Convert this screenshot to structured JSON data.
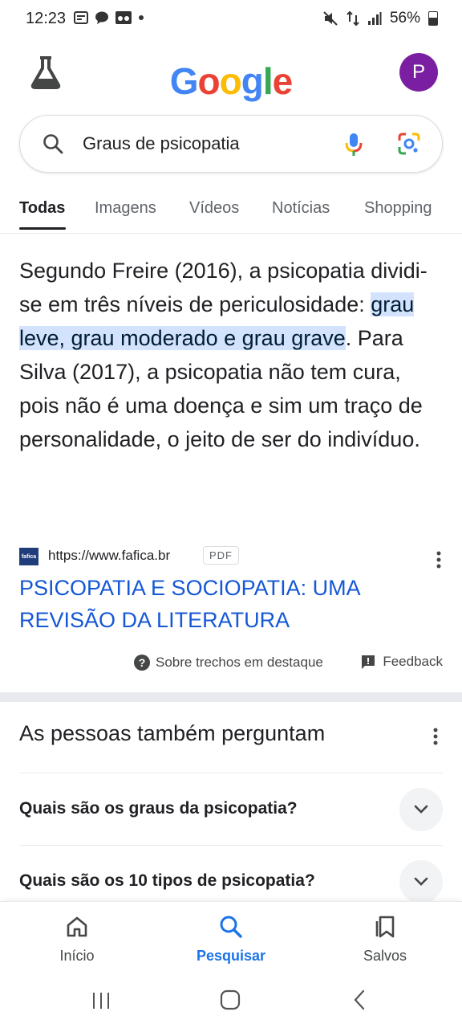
{
  "status_bar": {
    "time": "12:23",
    "battery": "56%"
  },
  "header": {
    "logo": [
      "G",
      "o",
      "o",
      "g",
      "l",
      "e"
    ],
    "logo_colors": [
      "#4285F4",
      "#EA4335",
      "#FBBC05",
      "#4285F4",
      "#34A853",
      "#EA4335"
    ],
    "avatar_initial": "P",
    "avatar_color": "#7b1fa2"
  },
  "search": {
    "query": "Graus de psicopatia"
  },
  "tabs": [
    {
      "label": "Todas",
      "active": true
    },
    {
      "label": "Imagens",
      "active": false
    },
    {
      "label": "Vídeos",
      "active": false
    },
    {
      "label": "Notícias",
      "active": false
    },
    {
      "label": "Shopping",
      "active": false
    }
  ],
  "featured_snippet": {
    "text_before": "Segundo Freire (2016), a psicopatia dividi-se em três níveis de periculosidade: ",
    "highlight": "grau leve, grau moderado e grau grave",
    "text_after": ". Para Silva (2017), a psicopatia não tem cura, pois não é uma doença e sim um traço de personalidade, o jeito de ser do indivíduo.",
    "source_url": "https://www.fafica.br",
    "badge": "PDF",
    "favicon_text": "fafica",
    "result_title": "PSICOPATIA E SOCIOPATIA: UMA REVISÃO DA LITERATURA",
    "about_label": "Sobre trechos em destaque",
    "feedback_label": "Feedback"
  },
  "people_also_ask": {
    "title": "As pessoas também perguntam",
    "questions": [
      "Quais são os graus da psicopatia?",
      "Quais são os 10 tipos de psicopatia?"
    ]
  },
  "bottom_nav": [
    {
      "label": "Início",
      "active": false
    },
    {
      "label": "Pesquisar",
      "active": true
    },
    {
      "label": "Salvos",
      "active": false
    }
  ]
}
